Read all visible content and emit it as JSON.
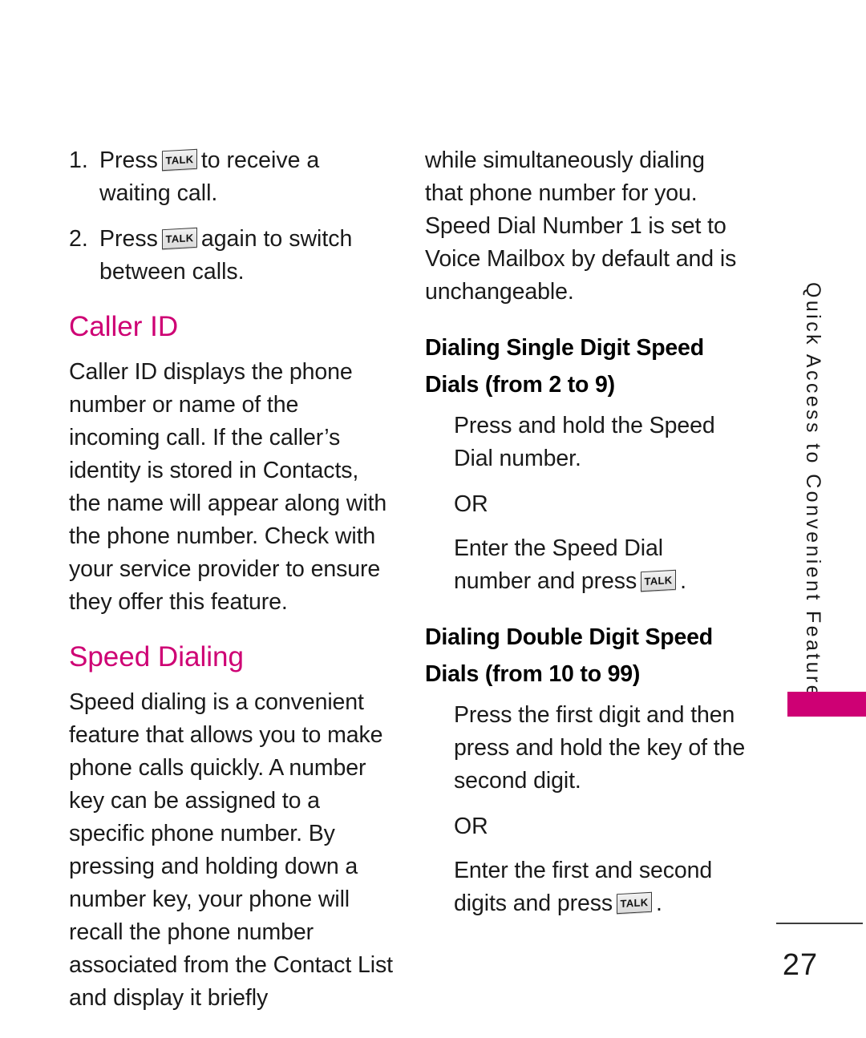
{
  "page": {
    "number": "27",
    "side_tab_label": "Quick Access to Convenient Features",
    "accent_color": "#CE0074",
    "text_color": "#1a1a1a"
  },
  "key_glyphs": {
    "talk": "TALK"
  },
  "left_column": {
    "steps": [
      {
        "num": "1.",
        "before": "Press",
        "after": "to receive a waiting call."
      },
      {
        "num": "2.",
        "before": "Press",
        "after": "again to switch between calls."
      }
    ],
    "caller_id": {
      "heading": "Caller ID",
      "body": "Caller ID displays the phone number or name of the incoming call. If the caller’s identity is stored in Contacts, the name will appear along with the phone number. Check with your service provider to ensure they offer this feature."
    },
    "speed_dialing": {
      "heading": "Speed Dialing",
      "body": "Speed dialing is a convenient feature that allows you to make phone calls quickly. A number key can be assigned to a specific phone number. By pressing and holding down a number key, your phone will recall the phone number associated from the Contact List and display it briefly"
    }
  },
  "right_column": {
    "continuation": "while simultaneously dialing that phone number for you. Speed Dial Number 1 is set to Voice Mailbox by default and is unchangeable.",
    "single_digit": {
      "heading": "Dialing Single Digit Speed Dials (from 2 to 9)",
      "step_one": "Press and hold the Speed Dial number.",
      "or": "OR",
      "step_two_before": "Enter the Speed Dial number and press",
      "step_two_after": "."
    },
    "double_digit": {
      "heading": "Dialing Double Digit Speed Dials (from 10 to 99)",
      "step_one": "Press the first digit and then press and hold the key of the second digit.",
      "or": "OR",
      "step_two_before": "Enter the first and second digits and press",
      "step_two_after": "."
    }
  }
}
